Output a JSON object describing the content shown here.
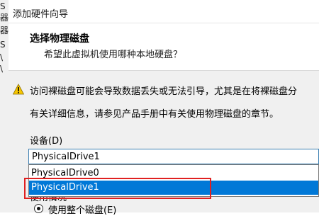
{
  "background_window": {
    "edge_text": [
      "S",
      "器",
      "器",
      "S",
      "\\",
      "\\"
    ]
  },
  "dialog": {
    "title": "添加硬件向导",
    "header": {
      "title": "选择物理磁盘",
      "subtitle": "希望此虚拟机使用哪种本地硬盘？"
    },
    "warning": {
      "line1": "访问裸磁盘可能会导致数据丢失或无法引导，尤其是在将裸磁盘分",
      "line2": "有关详细信息，请参见产品手册中有关使用物理磁盘的章节。"
    },
    "device": {
      "label": "设备(D)",
      "selected": "PhysicalDrive1",
      "options": [
        "PhysicalDrive0",
        "PhysicalDrive1"
      ],
      "highlighted_index": 1
    },
    "usage_group": {
      "label": "使用情况",
      "radio_label": "使用整个磁盘(E)"
    }
  },
  "colors": {
    "highlight": "#0078d7",
    "annotation_box": "#e02020",
    "panel_bg": "#f0f0f0"
  }
}
